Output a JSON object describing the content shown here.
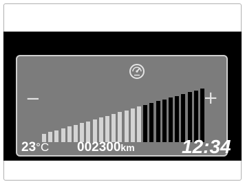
{
  "display": {
    "dimmer_minus_label": "−",
    "dimmer_plus_label": "+",
    "brightness_level": {
      "active_bars": 16,
      "total_bars": 26
    },
    "icon": "speedometer-icon"
  },
  "status_bar": {
    "temperature_value": "23",
    "temperature_unit": "°C",
    "odometer_value": "002300",
    "odometer_unit": "km",
    "clock": "12:34"
  },
  "colors": {
    "screen_bg": "#000000",
    "panel_bg": "#7c7c7c",
    "bar_active": "#d4d4d4",
    "bar_inactive": "#000000",
    "text": "#ffffff"
  }
}
